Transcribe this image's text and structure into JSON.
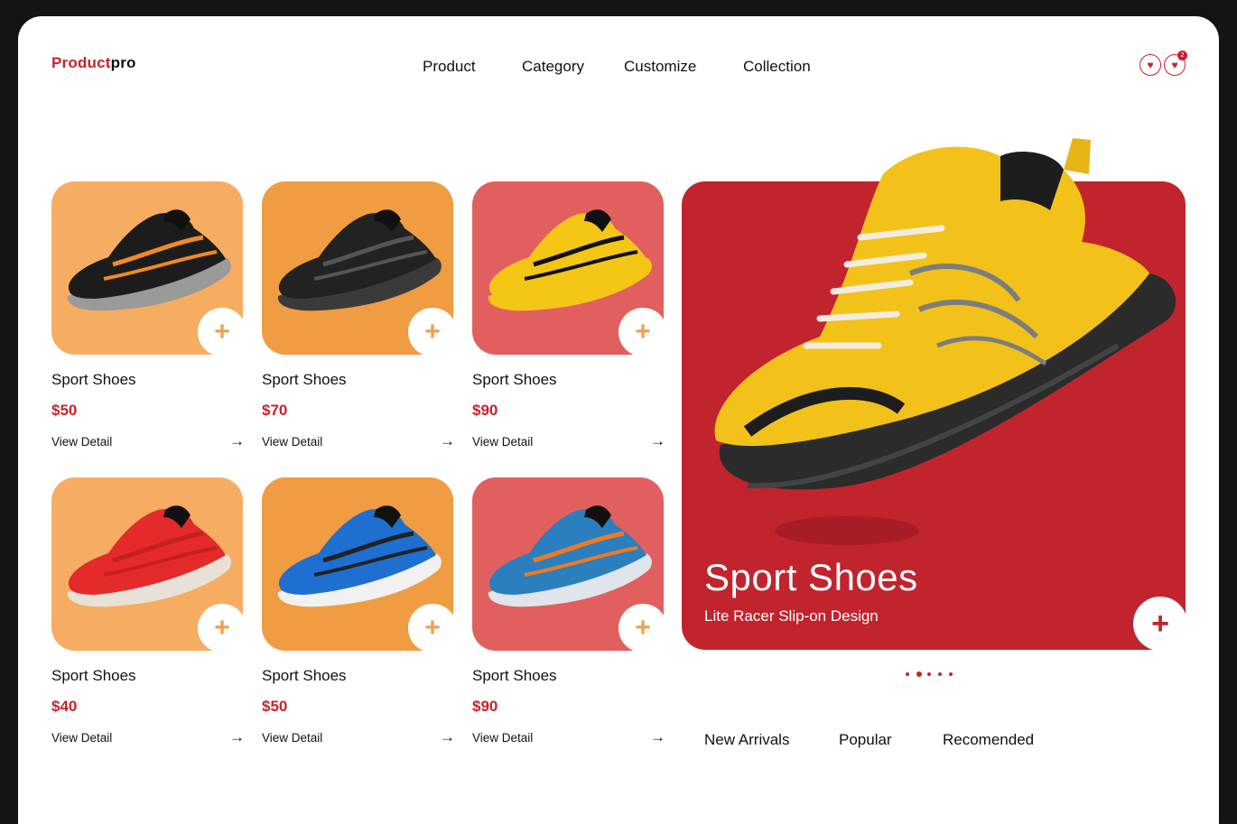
{
  "brand": {
    "part1": "Product",
    "part2": "pro",
    "accent": "#c8232b"
  },
  "nav": [
    {
      "label": "Product"
    },
    {
      "label": "Category"
    },
    {
      "label": "Customize"
    },
    {
      "label": "Collection"
    }
  ],
  "header_icons": {
    "wishlist_icon": "heart-icon",
    "cart_icon": "heart-icon",
    "cart_badge": "2"
  },
  "products": [
    {
      "name": "Sport Shoes",
      "price": "$50",
      "link": "View Detail",
      "tile_color": "#f6ad62",
      "shoe": "black-orange"
    },
    {
      "name": "Sport Shoes",
      "price": "$70",
      "link": "View Detail",
      "tile_color": "#ef9c43",
      "shoe": "black"
    },
    {
      "name": "Sport Shoes",
      "price": "$90",
      "link": "View Detail",
      "tile_color": "#e1605f",
      "shoe": "yellow"
    },
    {
      "name": "Sport Shoes",
      "price": "$40",
      "link": "View Detail",
      "tile_color": "#f6ad62",
      "shoe": "red"
    },
    {
      "name": "Sport Shoes",
      "price": "$50",
      "link": "View Detail",
      "tile_color": "#ef9c43",
      "shoe": "blue"
    },
    {
      "name": "Sport Shoes",
      "price": "$90",
      "link": "View Detail",
      "tile_color": "#e1605f",
      "shoe": "blue-orange"
    }
  ],
  "hero": {
    "title": "Sport Shoes",
    "subtitle": "Lite Racer Slip-on Design",
    "background": "#c1242d",
    "slides": 5,
    "active_slide": 1
  },
  "tabs": [
    {
      "label": "New Arrivals"
    },
    {
      "label": "Popular"
    },
    {
      "label": "Recomended"
    }
  ]
}
